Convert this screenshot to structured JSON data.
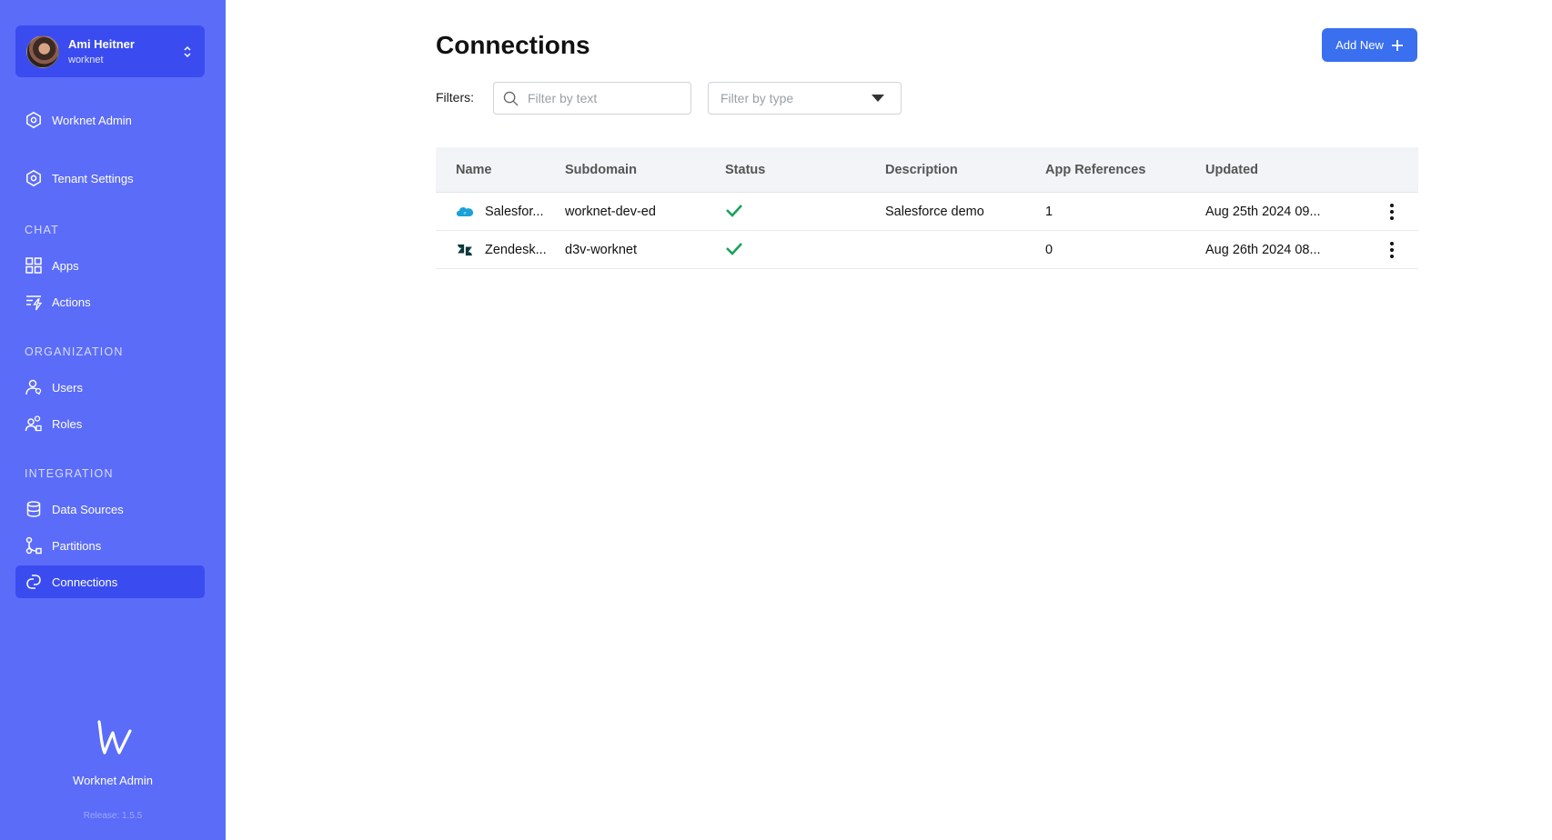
{
  "user": {
    "name": "Ami Heitner",
    "org": "worknet"
  },
  "sidebar": {
    "items": [
      {
        "label": "Worknet Admin",
        "icon": "hexagon-icon"
      },
      {
        "label": "Tenant Settings",
        "icon": "hexagon-icon"
      }
    ],
    "sections": [
      {
        "title": "CHAT",
        "items": [
          {
            "label": "Apps",
            "icon": "grid-icon"
          },
          {
            "label": "Actions",
            "icon": "bolt-list-icon"
          }
        ]
      },
      {
        "title": "ORGANIZATION",
        "items": [
          {
            "label": "Users",
            "icon": "users-icon"
          },
          {
            "label": "Roles",
            "icon": "roles-icon"
          }
        ]
      },
      {
        "title": "INTEGRATION",
        "items": [
          {
            "label": "Data Sources",
            "icon": "database-icon"
          },
          {
            "label": "Partitions",
            "icon": "partition-icon"
          },
          {
            "label": "Connections",
            "icon": "connections-icon",
            "active": true
          }
        ]
      }
    ],
    "brand": {
      "name": "Worknet Admin",
      "release": "Release: 1.5.5"
    }
  },
  "page": {
    "title": "Connections",
    "add_button": "Add New",
    "filters_label": "Filters:",
    "filter_text_placeholder": "Filter by text",
    "filter_type_placeholder": "Filter by type"
  },
  "table": {
    "columns": [
      "Name",
      "Subdomain",
      "Status",
      "Description",
      "App References",
      "Updated"
    ],
    "rows": [
      {
        "name": "Salesfor...",
        "icon": "salesforce-icon",
        "subdomain": "worknet-dev-ed",
        "status": "connected",
        "description": "Salesforce demo",
        "refs": "1",
        "updated": "Aug 25th 2024 09..."
      },
      {
        "name": "Zendesk...",
        "icon": "zendesk-icon",
        "subdomain": "d3v-worknet",
        "status": "connected",
        "description": "",
        "refs": "0",
        "updated": "Aug 26th 2024 08..."
      }
    ]
  },
  "colors": {
    "sidebar": "#5b6cf9",
    "sidebar_active": "#3a4cf0",
    "primary_button": "#3a6ff0",
    "check": "#1aa25a"
  }
}
